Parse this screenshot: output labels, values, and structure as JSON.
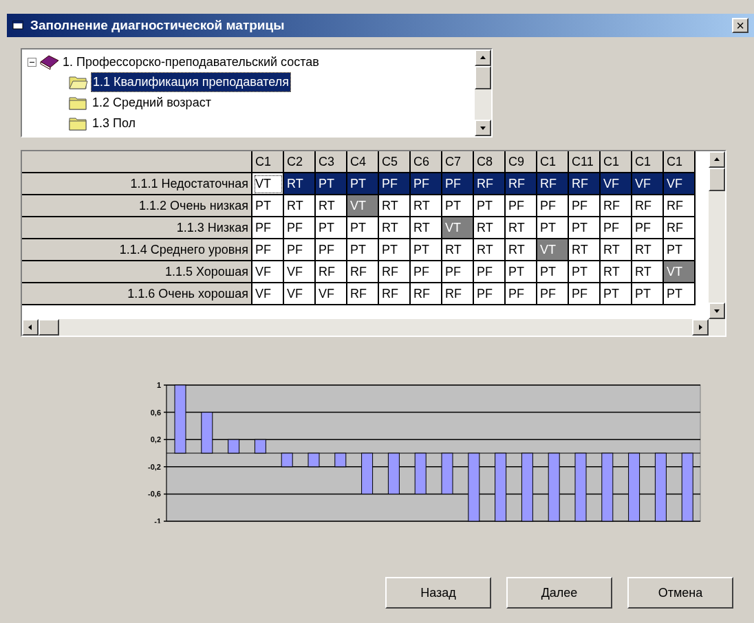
{
  "window": {
    "title": "Заполнение диагностической матрицы",
    "close": "×"
  },
  "tree": {
    "label": "1. Профессорско-преподавательский состав",
    "expanded": true,
    "children": [
      {
        "label": "1.1 Квалификация преподавателя",
        "selected": true
      },
      {
        "label": "1.2 Средний возраст",
        "selected": false
      },
      {
        "label": "1.3 Пол",
        "selected": false
      }
    ]
  },
  "grid": {
    "columns": [
      "C1",
      "C2",
      "C3",
      "C4",
      "C5",
      "C6",
      "C7",
      "C8",
      "C9",
      "C1",
      "C11",
      "C1",
      "C1",
      "C1"
    ],
    "rows": [
      {
        "label": "1.1.1 Недостаточная",
        "selected": true,
        "cells": [
          {
            "text": "VT",
            "shaded": false,
            "focused": true
          },
          {
            "text": "RT",
            "shaded": false,
            "focused": false
          },
          {
            "text": "PT",
            "shaded": false,
            "focused": false
          },
          {
            "text": "PT",
            "shaded": false,
            "focused": false
          },
          {
            "text": "PF",
            "shaded": false,
            "focused": false
          },
          {
            "text": "PF",
            "shaded": false,
            "focused": false
          },
          {
            "text": "PF",
            "shaded": false,
            "focused": false
          },
          {
            "text": "RF",
            "shaded": false,
            "focused": false
          },
          {
            "text": "RF",
            "shaded": false,
            "focused": false
          },
          {
            "text": "RF",
            "shaded": false,
            "focused": false
          },
          {
            "text": "RF",
            "shaded": false,
            "focused": false
          },
          {
            "text": "VF",
            "shaded": false,
            "focused": false
          },
          {
            "text": "VF",
            "shaded": false,
            "focused": false
          },
          {
            "text": "VF",
            "shaded": false,
            "focused": false
          }
        ]
      },
      {
        "label": "1.1.2 Очень низкая",
        "selected": false,
        "cells": [
          {
            "text": "PT",
            "shaded": false,
            "focused": false
          },
          {
            "text": "RT",
            "shaded": false,
            "focused": false
          },
          {
            "text": "RT",
            "shaded": false,
            "focused": false
          },
          {
            "text": "VT",
            "shaded": true,
            "focused": false
          },
          {
            "text": "RT",
            "shaded": false,
            "focused": false
          },
          {
            "text": "RT",
            "shaded": false,
            "focused": false
          },
          {
            "text": "PT",
            "shaded": false,
            "focused": false
          },
          {
            "text": "PT",
            "shaded": false,
            "focused": false
          },
          {
            "text": "PF",
            "shaded": false,
            "focused": false
          },
          {
            "text": "PF",
            "shaded": false,
            "focused": false
          },
          {
            "text": "PF",
            "shaded": false,
            "focused": false
          },
          {
            "text": "RF",
            "shaded": false,
            "focused": false
          },
          {
            "text": "RF",
            "shaded": false,
            "focused": false
          },
          {
            "text": "RF",
            "shaded": false,
            "focused": false
          }
        ]
      },
      {
        "label": "1.1.3 Низкая",
        "selected": false,
        "cells": [
          {
            "text": "PF",
            "shaded": false,
            "focused": false
          },
          {
            "text": "PF",
            "shaded": false,
            "focused": false
          },
          {
            "text": "PT",
            "shaded": false,
            "focused": false
          },
          {
            "text": "PT",
            "shaded": false,
            "focused": false
          },
          {
            "text": "RT",
            "shaded": false,
            "focused": false
          },
          {
            "text": "RT",
            "shaded": false,
            "focused": false
          },
          {
            "text": "VT",
            "shaded": true,
            "focused": false
          },
          {
            "text": "RT",
            "shaded": false,
            "focused": false
          },
          {
            "text": "RT",
            "shaded": false,
            "focused": false
          },
          {
            "text": "PT",
            "shaded": false,
            "focused": false
          },
          {
            "text": "PT",
            "shaded": false,
            "focused": false
          },
          {
            "text": "PF",
            "shaded": false,
            "focused": false
          },
          {
            "text": "PF",
            "shaded": false,
            "focused": false
          },
          {
            "text": "RF",
            "shaded": false,
            "focused": false
          }
        ]
      },
      {
        "label": "1.1.4 Среднего уровня",
        "selected": false,
        "cells": [
          {
            "text": "PF",
            "shaded": false,
            "focused": false
          },
          {
            "text": "PF",
            "shaded": false,
            "focused": false
          },
          {
            "text": "PF",
            "shaded": false,
            "focused": false
          },
          {
            "text": "PT",
            "shaded": false,
            "focused": false
          },
          {
            "text": "PT",
            "shaded": false,
            "focused": false
          },
          {
            "text": "PT",
            "shaded": false,
            "focused": false
          },
          {
            "text": "RT",
            "shaded": false,
            "focused": false
          },
          {
            "text": "RT",
            "shaded": false,
            "focused": false
          },
          {
            "text": "RT",
            "shaded": false,
            "focused": false
          },
          {
            "text": "VT",
            "shaded": true,
            "focused": false
          },
          {
            "text": "RT",
            "shaded": false,
            "focused": false
          },
          {
            "text": "RT",
            "shaded": false,
            "focused": false
          },
          {
            "text": "RT",
            "shaded": false,
            "focused": false
          },
          {
            "text": "PT",
            "shaded": false,
            "focused": false
          }
        ]
      },
      {
        "label": "1.1.5 Хорошая",
        "selected": false,
        "cells": [
          {
            "text": "VF",
            "shaded": false,
            "focused": false
          },
          {
            "text": "VF",
            "shaded": false,
            "focused": false
          },
          {
            "text": "RF",
            "shaded": false,
            "focused": false
          },
          {
            "text": "RF",
            "shaded": false,
            "focused": false
          },
          {
            "text": "RF",
            "shaded": false,
            "focused": false
          },
          {
            "text": "PF",
            "shaded": false,
            "focused": false
          },
          {
            "text": "PF",
            "shaded": false,
            "focused": false
          },
          {
            "text": "PF",
            "shaded": false,
            "focused": false
          },
          {
            "text": "PT",
            "shaded": false,
            "focused": false
          },
          {
            "text": "PT",
            "shaded": false,
            "focused": false
          },
          {
            "text": "PT",
            "shaded": false,
            "focused": false
          },
          {
            "text": "RT",
            "shaded": false,
            "focused": false
          },
          {
            "text": "RT",
            "shaded": false,
            "focused": false
          },
          {
            "text": "VT",
            "shaded": true,
            "focused": false
          }
        ]
      },
      {
        "label": "1.1.6 Очень хорошая",
        "selected": false,
        "cells": [
          {
            "text": "VF",
            "shaded": false,
            "focused": false
          },
          {
            "text": "VF",
            "shaded": false,
            "focused": false
          },
          {
            "text": "VF",
            "shaded": false,
            "focused": false
          },
          {
            "text": "RF",
            "shaded": false,
            "focused": false
          },
          {
            "text": "RF",
            "shaded": false,
            "focused": false
          },
          {
            "text": "RF",
            "shaded": false,
            "focused": false
          },
          {
            "text": "RF",
            "shaded": false,
            "focused": false
          },
          {
            "text": "PF",
            "shaded": false,
            "focused": false
          },
          {
            "text": "PF",
            "shaded": false,
            "focused": false
          },
          {
            "text": "PF",
            "shaded": false,
            "focused": false
          },
          {
            "text": "PF",
            "shaded": false,
            "focused": false
          },
          {
            "text": "PT",
            "shaded": false,
            "focused": false
          },
          {
            "text": "PT",
            "shaded": false,
            "focused": false
          },
          {
            "text": "PT",
            "shaded": false,
            "focused": false
          }
        ]
      }
    ]
  },
  "chart": {
    "chart_data": {
      "type": "bar",
      "grid": true,
      "ylim": [
        -1,
        1
      ],
      "yticks": [
        {
          "value": 1,
          "label": "1"
        },
        {
          "value": 0.6,
          "label": "0,6"
        },
        {
          "value": 0.2,
          "label": "0,2"
        },
        {
          "value": -0.2,
          "label": "-0,2"
        },
        {
          "value": -0.6,
          "label": "-0,6"
        },
        {
          "value": -1,
          "label": "-1"
        }
      ],
      "series": [
        {
          "color": "#9999ff",
          "values": [
            1,
            0.6,
            0.2,
            0.2,
            -0.2,
            -0.2,
            -0.2,
            -0.6,
            -0.6,
            -0.6,
            -0.6,
            -1,
            -1,
            -1,
            -1,
            -1,
            -1,
            -1,
            -1,
            -1
          ]
        }
      ]
    }
  },
  "buttons": [
    "Назад",
    "Далее",
    "Отмена"
  ]
}
